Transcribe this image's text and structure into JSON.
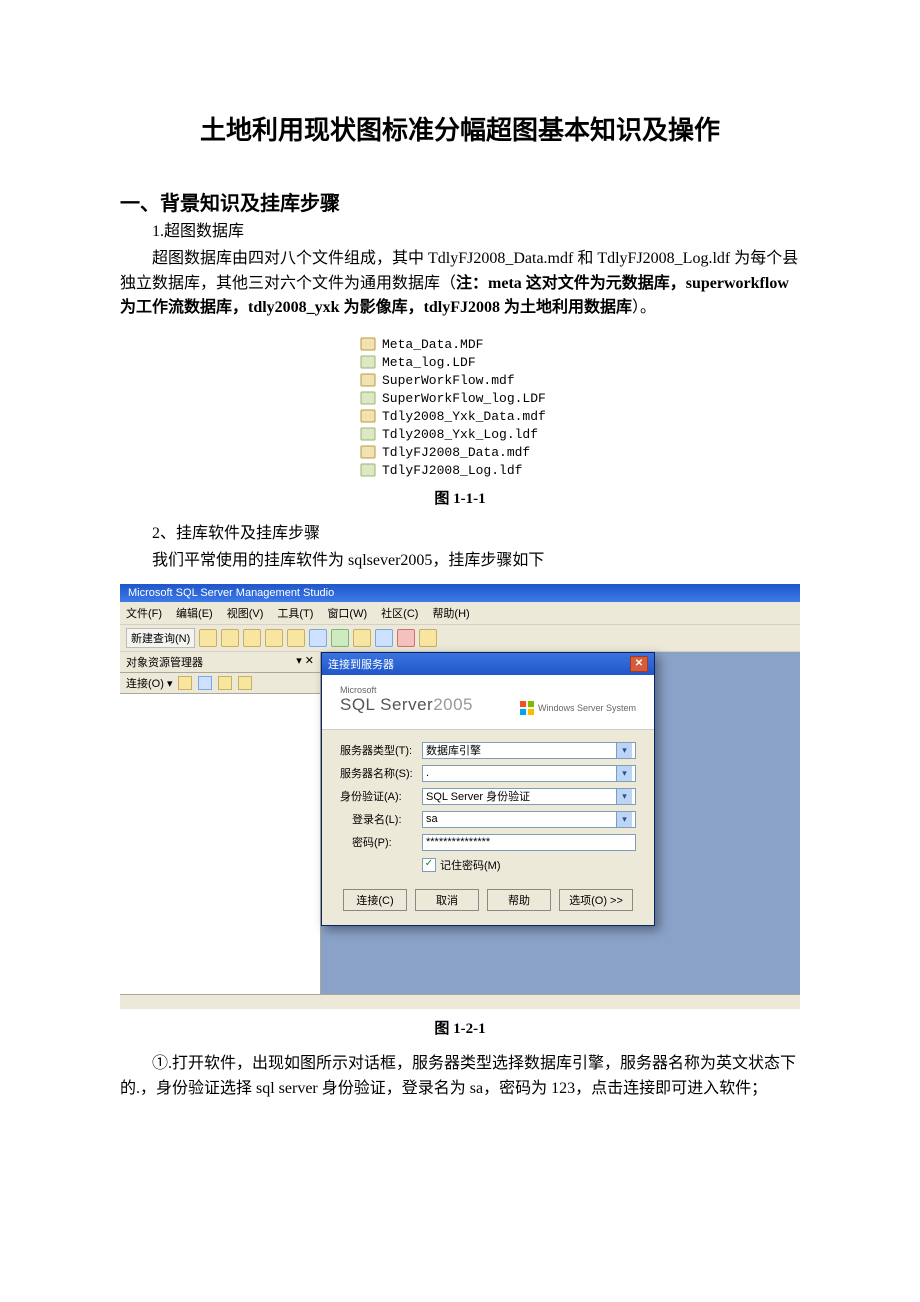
{
  "doc": {
    "title": "土地利用现状图标准分幅超图基本知识及操作",
    "section1_header": "一、背景知识及挂库步骤",
    "sub1": "1.超图数据库",
    "para1_a": "超图数据库由四对八个文件组成，其中 TdlyFJ2008_Data.mdf 和 TdlyFJ2008_Log.ldf 为每个县独立数据库，其他三对六个文件为通用数据库（",
    "para1_bold": "注：meta 这对文件为元数据库，superworkflow 为工作流数据库，tdly2008_yxk 为影像库，tdlyFJ2008 为土地利用数据库",
    "para1_b": "）。",
    "files": [
      {
        "name": "Meta_Data.MDF",
        "type": "mdf"
      },
      {
        "name": "Meta_log.LDF",
        "type": "ldf"
      },
      {
        "name": "SuperWorkFlow.mdf",
        "type": "mdf"
      },
      {
        "name": "SuperWorkFlow_log.LDF",
        "type": "ldf"
      },
      {
        "name": "Tdly2008_Yxk_Data.mdf",
        "type": "mdf"
      },
      {
        "name": "Tdly2008_Yxk_Log.ldf",
        "type": "ldf"
      },
      {
        "name": "TdlyFJ2008_Data.mdf",
        "type": "mdf"
      },
      {
        "name": "TdlyFJ2008_Log.ldf",
        "type": "ldf"
      }
    ],
    "fig1_caption": "图 1-1-1",
    "sub2": "2、挂库软件及挂库步骤",
    "para2": "我们平常使用的挂库软件为 sqlsever2005，挂库步骤如下",
    "fig2_caption": "图 1-2-1",
    "para3": "①.打开软件，出现如图所示对话框，服务器类型选择数据库引擎，服务器名称为英文状态下的.，身份验证选择 sql server 身份验证，登录名为 sa，密码为 123，点击连接即可进入软件；"
  },
  "ssms": {
    "title": "Microsoft SQL Server Management Studio",
    "menu": {
      "file": "文件(F)",
      "edit": "编辑(E)",
      "view": "视图(V)",
      "tools": "工具(T)",
      "window": "窗口(W)",
      "community": "社区(C)",
      "help": "帮助(H)"
    },
    "toolbar": {
      "new_query": "新建查询(N)"
    },
    "object_explorer": {
      "title": "对象资源管理器",
      "pin_close": "▾ ✕",
      "connect": "连接(O) ▾"
    },
    "dialog": {
      "title": "连接到服务器",
      "brand_ms": "Microsoft",
      "brand_sql": "SQL Server",
      "brand_year": "2005",
      "brand_right": "Windows Server System",
      "server_type_label": "服务器类型(T):",
      "server_type_value": "数据库引擎",
      "server_name_label": "服务器名称(S):",
      "server_name_value": ".",
      "auth_label": "身份验证(A):",
      "auth_value": "SQL Server 身份验证",
      "login_label": "登录名(L):",
      "login_value": "sa",
      "password_label": "密码(P):",
      "password_value": "***************",
      "remember": "记住密码(M)",
      "btn_connect": "连接(C)",
      "btn_cancel": "取消",
      "btn_help": "帮助",
      "btn_options": "选项(O) >>"
    }
  }
}
